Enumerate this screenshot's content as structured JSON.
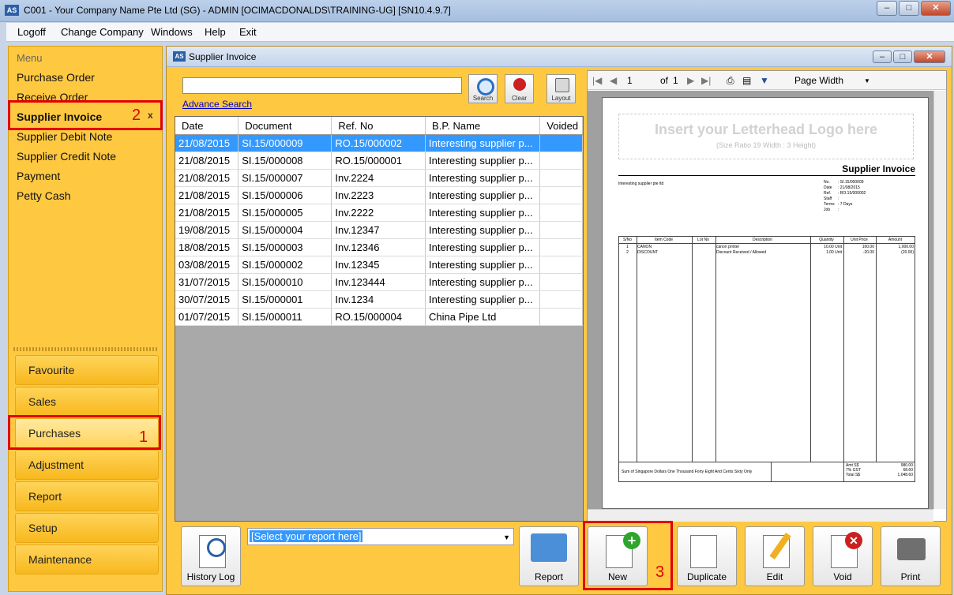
{
  "window": {
    "title": "C001 - Your Company Name Pte Ltd (SG) - ADMIN [OCIMACDONALDS\\TRAINING-UG] [SN10.4.9.7]",
    "app_icon": "AS"
  },
  "menubar": {
    "items": [
      "Logoff",
      "Change Company",
      "Windows",
      "Help",
      "Exit"
    ]
  },
  "sidebar": {
    "header": "Menu",
    "links": [
      "Purchase Order",
      "Receive Order",
      "Supplier Invoice",
      "Supplier Debit Note",
      "Supplier Credit Note",
      "Payment",
      "Petty Cash"
    ],
    "active_close": "x",
    "sections": [
      "Favourite",
      "Sales",
      "Purchases",
      "Adjustment",
      "Report",
      "Setup",
      "Maintenance"
    ]
  },
  "annotations": {
    "step1": "1",
    "step2": "2",
    "step3": "3"
  },
  "child": {
    "title": "Supplier Invoice",
    "icon": "AS",
    "search_value": "",
    "advanced_search": "Advance Search",
    "toolbar": {
      "search": "Search",
      "clear": "Clear",
      "layout": "Layout"
    }
  },
  "grid": {
    "columns": [
      "Date",
      "Document",
      "Ref. No",
      "B.P. Name",
      "Voided"
    ],
    "rows": [
      [
        "21/08/2015",
        "SI.15/000009",
        "RO.15/000002",
        "Interesting supplier p...",
        ""
      ],
      [
        "21/08/2015",
        "SI.15/000008",
        "RO.15/000001",
        "Interesting supplier p...",
        ""
      ],
      [
        "21/08/2015",
        "SI.15/000007",
        "Inv.2224",
        "Interesting supplier p...",
        ""
      ],
      [
        "21/08/2015",
        "SI.15/000006",
        "Inv.2223",
        "Interesting supplier p...",
        ""
      ],
      [
        "21/08/2015",
        "SI.15/000005",
        "Inv.2222",
        "Interesting supplier p...",
        ""
      ],
      [
        "19/08/2015",
        "SI.15/000004",
        "Inv.12347",
        "Interesting supplier p...",
        ""
      ],
      [
        "18/08/2015",
        "SI.15/000003",
        "Inv.12346",
        "Interesting supplier p...",
        ""
      ],
      [
        "03/08/2015",
        "SI.15/000002",
        "Inv.12345",
        "Interesting supplier p...",
        ""
      ],
      [
        "31/07/2015",
        "SI.15/000010",
        "Inv.123444",
        "Interesting supplier p...",
        ""
      ],
      [
        "30/07/2015",
        "SI.15/000001",
        "Inv.1234",
        "Interesting supplier p...",
        ""
      ],
      [
        "01/07/2015",
        "SI.15/000011",
        "RO.15/000004",
        "China Pipe Ltd",
        ""
      ]
    ],
    "selected_row": 0
  },
  "preview": {
    "page": "1",
    "of": "of",
    "total": "1",
    "zoom": "Page Width",
    "letterhead": "Insert your Letterhead Logo here",
    "letterhead_hint": "(Size Ratio 19 Width : 3 Height)",
    "doc_title": "Supplier Invoice",
    "supplier": "Interesting supplier pte ltd",
    "meta_labels": [
      "No.",
      "Date",
      "Ref.",
      "Staff",
      "Terms",
      "Job"
    ],
    "meta_values": [
      ": SI.15/000009",
      ": 21/08/2015",
      ": RO.15/000002",
      ":",
      ": 7 Days",
      ":"
    ],
    "table_headers": [
      "S/No",
      "Item Code",
      "Lot No",
      "Description",
      "Quantity",
      "Unit Price",
      "Amount"
    ],
    "lines": [
      [
        "1",
        "CANON",
        "",
        "canon printer",
        "10.00 Unit",
        "100.00",
        "1,000.00"
      ],
      [
        "2",
        "DISCOUNT",
        "",
        "Discount Received / Allowed",
        "1.00 Unit",
        "-20.00",
        "(20.00)"
      ]
    ],
    "amount_in_words": "Sum of Singapore Dollars One Thousand Forty Eight And Cents Sixty Only",
    "totals_labels": [
      "Amt S$",
      "7% GST",
      "Total S$"
    ],
    "totals_values": [
      "980.00",
      "68.60",
      "1,048.60"
    ]
  },
  "bottom": {
    "history_log": "History Log",
    "report_placeholder": "[Select your report here]",
    "report": "Report",
    "new": "New",
    "duplicate": "Duplicate",
    "edit": "Edit",
    "void": "Void",
    "print": "Print"
  }
}
